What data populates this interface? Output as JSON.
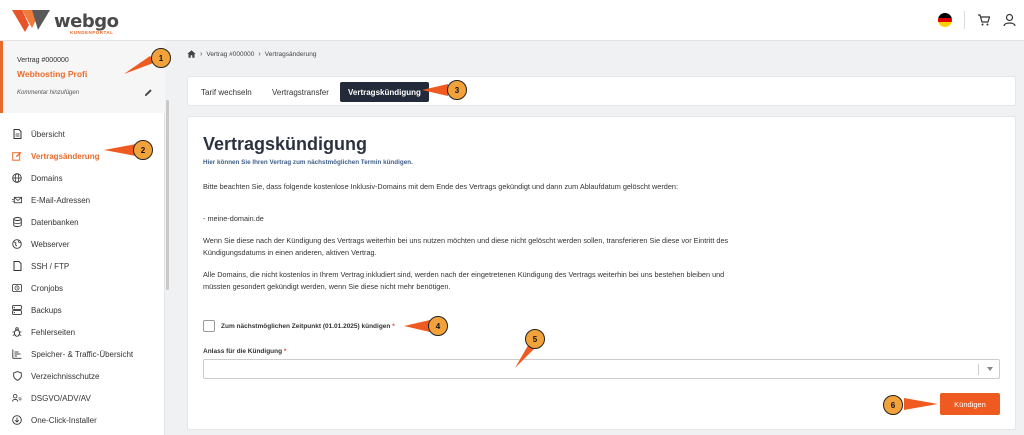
{
  "brand": {
    "name": "webgo",
    "sub": "KUNDENPORTAL"
  },
  "header": {
    "flag_colors": [
      "#000000",
      "#dd0000",
      "#ffce00"
    ]
  },
  "sidebar": {
    "contract_id": "Vertrag #000000",
    "contract_name": "Webhosting Profi",
    "comment_label": "Kommentar hinzufügen",
    "items": [
      {
        "label": "Übersicht",
        "icon": "document-icon"
      },
      {
        "label": "Vertragsänderung",
        "icon": "edit-icon",
        "active": true
      },
      {
        "label": "Domains",
        "icon": "globe-icon"
      },
      {
        "label": "E-Mail-Adressen",
        "icon": "mail-icon"
      },
      {
        "label": "Datenbanken",
        "icon": "database-icon"
      },
      {
        "label": "Webserver",
        "icon": "web-globe-icon"
      },
      {
        "label": "SSH / FTP",
        "icon": "file-icon"
      },
      {
        "label": "Cronjobs",
        "icon": "clock-icon"
      },
      {
        "label": "Backups",
        "icon": "server-icon"
      },
      {
        "label": "Fehlerseiten",
        "icon": "bug-icon"
      },
      {
        "label": "Speicher- & Traffic-Übersicht",
        "icon": "chart-icon"
      },
      {
        "label": "Verzeichnisschutze",
        "icon": "shield-icon"
      },
      {
        "label": "DSGVO/ADV/AV",
        "icon": "users-icon"
      },
      {
        "label": "One-Click-Installer",
        "icon": "download-icon"
      }
    ]
  },
  "breadcrumb": {
    "items": [
      "Vertrag #000000",
      "Vertragsänderung"
    ]
  },
  "tabs": [
    {
      "label": "Tarif wechseln"
    },
    {
      "label": "Vertragstransfer"
    },
    {
      "label": "Vertragskündigung",
      "active": true
    }
  ],
  "main": {
    "title": "Vertragskündigung",
    "subtitle": "Hier können Sie Ihren Vertrag zum nächstmöglichen Termin kündigen.",
    "para1": "Bitte beachten Sie, dass folgende kostenlose Inklusiv-Domains mit dem Ende des Vertrags gekündigt und dann zum Ablaufdatum gelöscht werden:",
    "domain": "- meine-domain.de",
    "para2": "Wenn Sie diese nach der Kündigung des Vertrags weiterhin bei uns nutzen möchten und diese nicht gelöscht werden sollen, transferieren Sie diese vor Eintritt des Kündigungsdatums in einen anderen, aktiven Vertrag.",
    "para3": "Alle Domains, die nicht kostenlos in Ihrem Vertrag inkludiert sind, werden nach der eingetretenen Kündigung des Vertrags weiterhin bei uns bestehen bleiben und müssten gesondert gekündigt werden, wenn Sie diese nicht mehr benötigen.",
    "checkbox_label": "Zum nächstmöglichen Zeitpunkt (01.01.2025) kündigen",
    "required_mark": "*",
    "reason_label": "Anlass für die Kündigung",
    "reason_value": "",
    "submit_label": "Kündigen"
  },
  "callouts": [
    "1",
    "2",
    "3",
    "4",
    "5",
    "6"
  ],
  "colors": {
    "accent": "#e96b2b",
    "tab_active": "#232b3a",
    "button": "#ee5a1f",
    "callout": "#f2a23a"
  }
}
